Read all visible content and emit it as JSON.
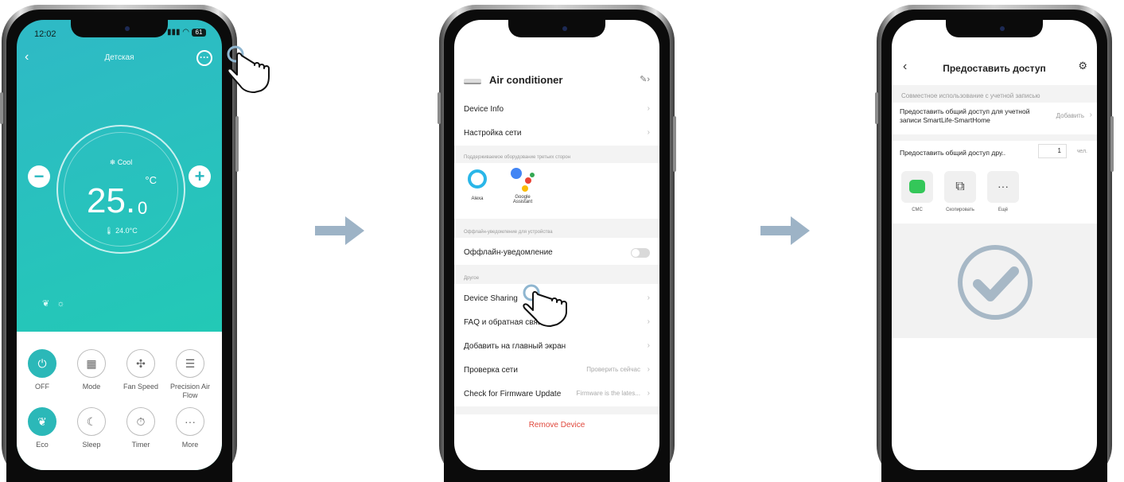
{
  "phone1": {
    "status_time": "12:02",
    "battery": "61",
    "room_title": "Детская",
    "more_glyph": "···",
    "mode_text": "❄ Cool",
    "temp_unit": "°C",
    "temp_int": "25.",
    "temp_dec": "0",
    "indoor_text": "🌡 24.0°C",
    "minus": "−",
    "plus": "+",
    "controls": [
      {
        "icon": "power-icon",
        "glyph": "⏻",
        "label": "OFF",
        "active": true
      },
      {
        "icon": "mode-icon",
        "glyph": "▦",
        "label": "Mode",
        "active": false
      },
      {
        "icon": "fan-speed-icon",
        "glyph": "✣",
        "label": "Fan Speed",
        "active": false
      },
      {
        "icon": "air-flow-icon",
        "glyph": "☰",
        "label": "Precision Air Flow",
        "active": false
      },
      {
        "icon": "eco-icon",
        "glyph": "❦",
        "label": "Eco",
        "active": true
      },
      {
        "icon": "sleep-icon",
        "glyph": "☾",
        "label": "Sleep",
        "active": false
      },
      {
        "icon": "timer-icon",
        "glyph": "⏱",
        "label": "Timer",
        "active": false
      },
      {
        "icon": "more-icon",
        "glyph": "···",
        "label": "More",
        "active": false
      }
    ]
  },
  "phone2": {
    "device_name": "Air conditioner",
    "rows": {
      "device_info": "Device Info",
      "network_setup": "Настройка сети",
      "offline_notify": "Оффлайн-уведомление",
      "device_sharing": "Device Sharing",
      "faq": "FAQ и обратная связь",
      "add_home": "Добавить на главный экран",
      "check_network": "Проверка сети",
      "check_network_value": "Проверить сейчас",
      "firmware": "Check for Firmware Update",
      "firmware_value": "Firmware is the lates..."
    },
    "sections": {
      "third_party": "Поддерживаемое оборудование третьих сторон",
      "offline": "Оффлайн-уведомление для устройства",
      "other": "Другое"
    },
    "assistants": [
      {
        "name": "Alexa"
      },
      {
        "name": "Google Assistant"
      }
    ],
    "remove": "Remove Device"
  },
  "phone3": {
    "title": "Предоставить доступ",
    "section": "Совместное использование с учетной записью",
    "share_account": "Предоставить общий доступ для учетной записи SmartLife-SmartHome",
    "add": "Добавить",
    "share_friends": "Предоставить общий доступ дру..",
    "count": "1",
    "unit": "чел.",
    "options": [
      {
        "icon": "message-icon",
        "label": "СМС"
      },
      {
        "icon": "copy-icon",
        "label": "Скопировать"
      },
      {
        "icon": "more-icon",
        "label": "Ещё"
      }
    ]
  },
  "colors": {
    "teal": "#2bb8c0",
    "accent_red": "#e0483c",
    "arrow": "#9db3c6"
  }
}
